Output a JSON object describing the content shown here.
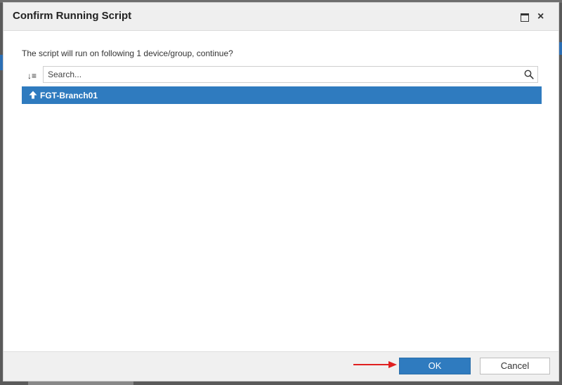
{
  "dialog": {
    "title": "Confirm Running Script",
    "message": "The script will run on following 1 device/group, continue?"
  },
  "search": {
    "placeholder": "Search...",
    "value": ""
  },
  "list": {
    "items": [
      {
        "label": "FGT-Branch01",
        "icon": "up-arrow-icon"
      }
    ]
  },
  "footer": {
    "ok_label": "OK",
    "cancel_label": "Cancel"
  },
  "colors": {
    "accent": "#2f7bbf",
    "annotation_arrow": "#e02020"
  },
  "icons": {
    "maximize": "maximize-icon",
    "close": "close-icon",
    "sort": "sort-icon",
    "search": "search-icon",
    "close_glyph": "×",
    "sort_glyph": "↓≡"
  }
}
